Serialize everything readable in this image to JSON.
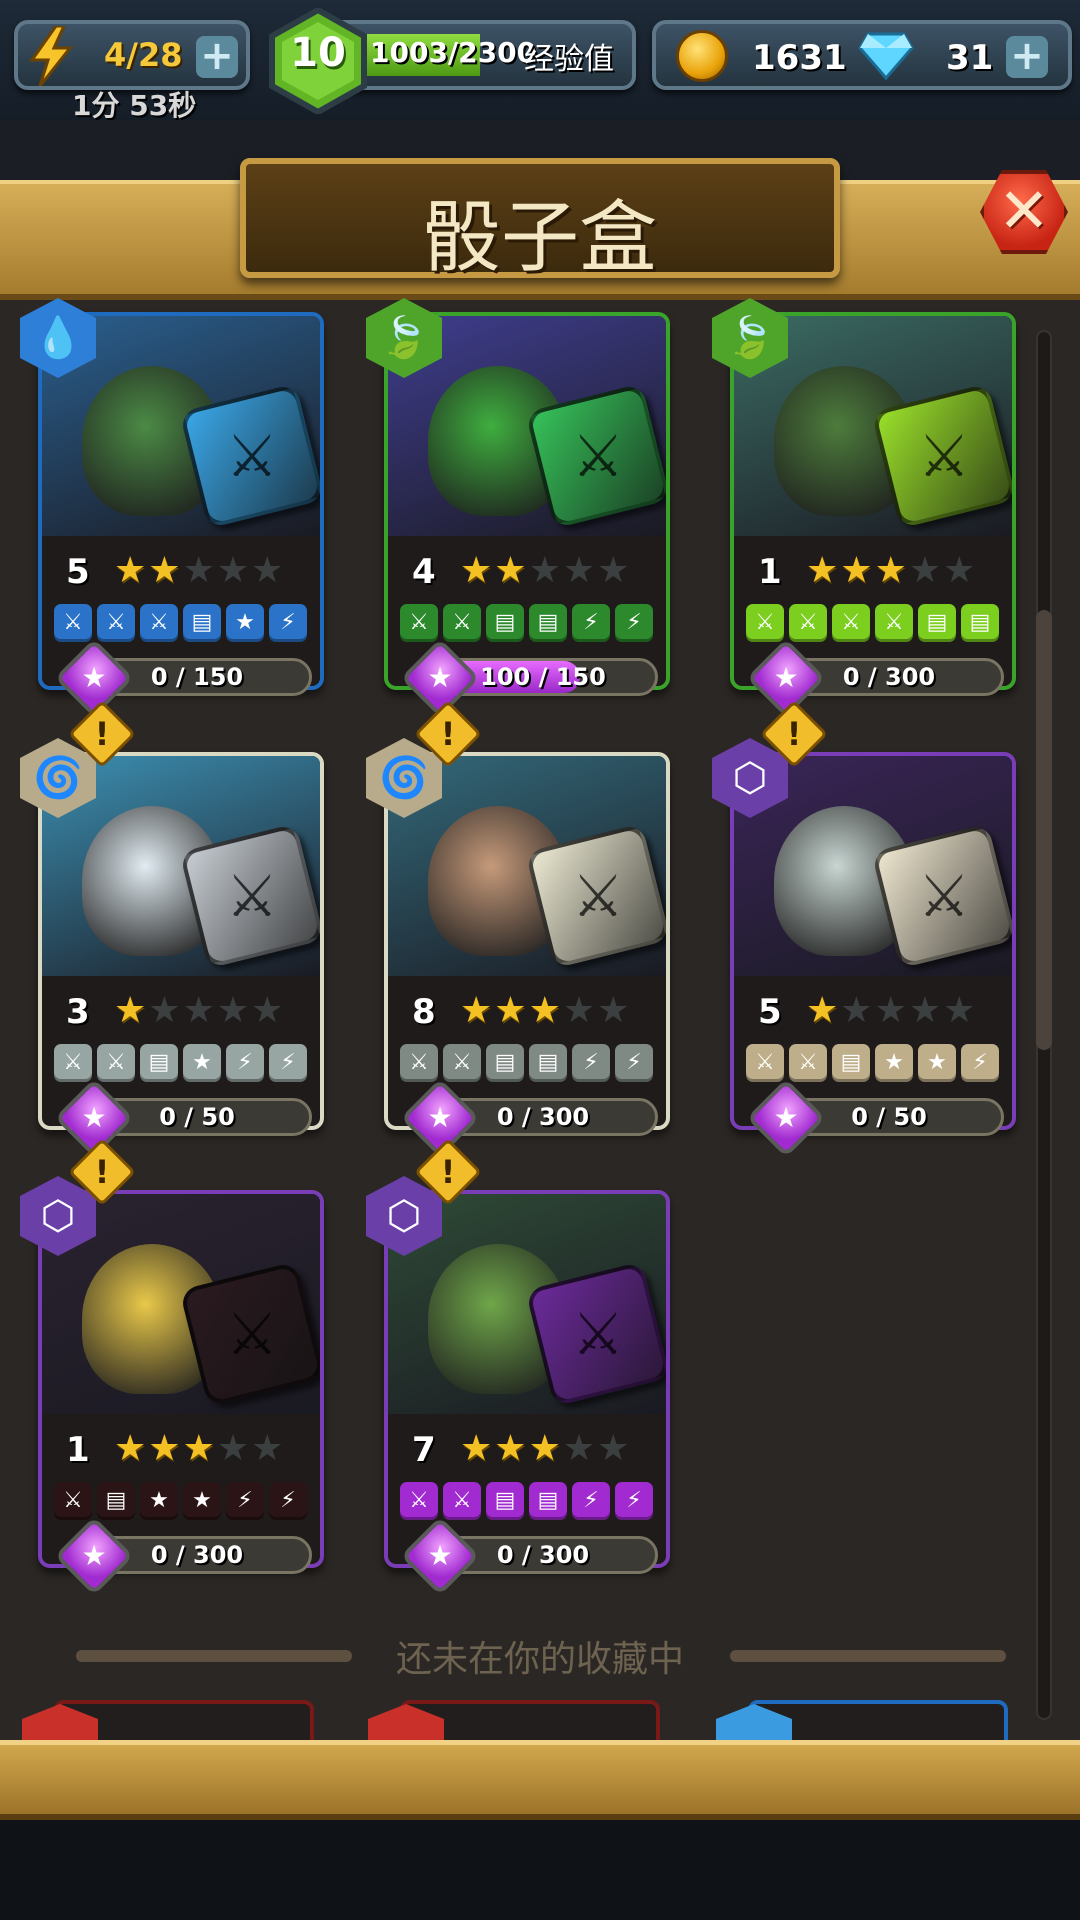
{
  "top_bar": {
    "energy": {
      "value": "4/28",
      "timer": "1分 53秒",
      "icon": "lightning-bolt-icon"
    },
    "level": {
      "value": "10",
      "xp": "1003/2300",
      "xp_label": "经验值",
      "xp_progress": 0.436
    },
    "coins": {
      "value": "1631",
      "icon": "coin-icon"
    },
    "gems": {
      "value": "31",
      "icon": "diamond-icon"
    },
    "plus_label": "+"
  },
  "header": {
    "title": "骰子盒",
    "close_icon": "close-icon",
    "close_label": "✕"
  },
  "cards": [
    {
      "count": "5",
      "stars": 2,
      "type": "water",
      "type_glyph": "💧",
      "progress": "0 / 150",
      "progress_fill": 0.0,
      "alert": false,
      "frame": "#1e6bc0",
      "art_bg": "#2a5f8e",
      "monster": "#4b8a45",
      "die": "#3aa7e8",
      "faces": [
        "⚔",
        "⚔",
        "⚔",
        "▤",
        "★",
        "⚡"
      ],
      "face_color": "#2a73c8"
    },
    {
      "count": "4",
      "stars": 2,
      "type": "nature",
      "type_glyph": "🍃",
      "progress": "100 / 150",
      "progress_fill": 0.667,
      "alert": false,
      "frame": "#3aa32a",
      "art_bg": "#3f3d8e",
      "monster": "#3fae3f",
      "die": "#36c25a",
      "faces": [
        "⚔",
        "⚔",
        "▤",
        "▤",
        "⚡",
        "⚡"
      ],
      "face_color": "#2c8a2c"
    },
    {
      "count": "1",
      "stars": 3,
      "type": "nature",
      "type_glyph": "🍃",
      "progress": "0 / 300",
      "progress_fill": 0.0,
      "alert": false,
      "frame": "#3aa32a",
      "art_bg": "#3b6b63",
      "monster": "#4d7c3c",
      "die": "#9ae02a",
      "faces": [
        "⚔",
        "⚔",
        "⚔",
        "⚔",
        "▤",
        "▤"
      ],
      "face_color": "#7ccf1f"
    },
    {
      "count": "3",
      "stars": 1,
      "type": "wind",
      "type_glyph": "🌀",
      "progress": "0 / 50",
      "progress_fill": 0.0,
      "alert": true,
      "frame": "#d9d9c4",
      "art_bg": "#3c8fb2",
      "monster": "#e1ecf2",
      "die": "#c7cdd3",
      "faces": [
        "⚔",
        "⚔",
        "▤",
        "★",
        "⚡",
        "⚡"
      ],
      "face_color": "#98a6a3"
    },
    {
      "count": "8",
      "stars": 3,
      "type": "wind",
      "type_glyph": "🌀",
      "progress": "0 / 300",
      "progress_fill": 0.0,
      "alert": true,
      "frame": "#d9d9c4",
      "art_bg": "#33697a",
      "monster": "#c69a7a",
      "die": "#ece9d2",
      "faces": [
        "⚔",
        "⚔",
        "▤",
        "▤",
        "⚡",
        "⚡"
      ],
      "face_color": "#7f8a84"
    },
    {
      "count": "5",
      "stars": 1,
      "type": "shadow",
      "type_glyph": "⬡",
      "progress": "0 / 50",
      "progress_fill": 0.0,
      "alert": true,
      "frame": "#7a3db8",
      "art_bg": "#3a2558",
      "monster": "#c8d6d2",
      "die": "#eee6cf",
      "faces": [
        "⚔",
        "⚔",
        "▤",
        "★",
        "★",
        "⚡"
      ],
      "face_color": "#bfae8a"
    },
    {
      "count": "1",
      "stars": 3,
      "type": "shadow",
      "type_glyph": "⬡",
      "progress": "0 / 300",
      "progress_fill": 0.0,
      "alert": true,
      "frame": "#7a3db8",
      "art_bg": "#2a2230",
      "monster": "#e9c84a",
      "die": "#2a1a20",
      "faces": [
        "⚔",
        "▤",
        "★",
        "★",
        "⚡",
        "⚡"
      ],
      "face_color": "#2a1416"
    },
    {
      "count": "7",
      "stars": 3,
      "type": "shadow",
      "type_glyph": "⬡",
      "progress": "0 / 300",
      "progress_fill": 0.0,
      "alert": true,
      "frame": "#7a3db8",
      "art_bg": "#2e4a36",
      "monster": "#6fa64a",
      "die": "#6b2a9a",
      "faces": [
        "⚔",
        "⚔",
        "▤",
        "▤",
        "⚡",
        "⚡"
      ],
      "face_color": "#a12bd0"
    }
  ],
  "section": {
    "not_collected_label": "还未在你的收藏中"
  },
  "colors": {
    "accent_gold": "#f4c124",
    "progress_purple": "#a12bd0",
    "board_wood": "#c69a43"
  }
}
